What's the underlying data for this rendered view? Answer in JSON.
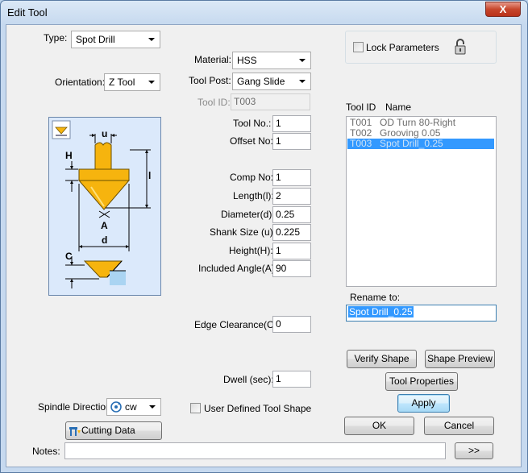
{
  "window": {
    "title": "Edit Tool",
    "close_glyph": "X"
  },
  "labels": {
    "type": "Type:",
    "orientation": "Orientation:",
    "material": "Material:",
    "tool_post": "Tool Post:",
    "tool_id": "Tool ID:",
    "tool_no": "Tool No.:",
    "offset_no": "Offset No:",
    "comp_no": "Comp No:",
    "length": "Length(l):",
    "diameter": "Diameter(d):",
    "shank_size": "Shank Size (u):",
    "height": "Height(H):",
    "included_angle": "Included Angle(A):",
    "edge_clearance": "Edge Clearance(C):",
    "dwell": "Dwell (sec):",
    "spindle_direction": "Spindle Direction:",
    "notes": "Notes:",
    "rename_to": "Rename to:",
    "lock_parameters": "Lock Parameters",
    "user_defined_shape": "User Defined Tool Shape"
  },
  "fields": {
    "type": "Spot Drill",
    "orientation": "Z Tool",
    "material": "HSS",
    "tool_post": "Gang Slide",
    "tool_id": "T003",
    "tool_no": "1",
    "offset_no": "1",
    "comp_no": "1",
    "length": "2",
    "diameter": "0.25",
    "shank_size": "0.225",
    "height": "1",
    "included_angle": "90",
    "edge_clearance": "0",
    "dwell": "1",
    "spindle_direction": "cw",
    "rename_to": "Spot Drill_0.25",
    "notes": ""
  },
  "tool_list": {
    "headers": {
      "id": "Tool ID",
      "name": "Name"
    },
    "rows": [
      {
        "id": "T001",
        "name": "OD Turn 80-Right",
        "selected": false
      },
      {
        "id": "T002",
        "name": "Grooving 0.05",
        "selected": false
      },
      {
        "id": "T003",
        "name": "Spot Drill_0.25",
        "selected": true
      }
    ]
  },
  "buttons": {
    "verify_shape": "Verify Shape",
    "shape_preview": "Shape Preview",
    "tool_properties": "Tool Properties",
    "apply": "Apply",
    "ok": "OK",
    "cancel": "Cancel",
    "cutting_data": "Cutting Data",
    "notes_expand": ">>"
  },
  "diagram": {
    "labels": {
      "u": "u",
      "H": "H",
      "l": "l",
      "A": "A",
      "d": "d",
      "C": "C"
    }
  },
  "icons": {
    "lock": "padlock-icon",
    "spindle": "spindle-rotation-icon",
    "cutting": "cutting-data-icon",
    "orient": "orientation-icon"
  },
  "colors": {
    "accent_selection": "#3399ff",
    "tool_gold": "#f6b40e",
    "diagram_bg": "#dbe9fb"
  }
}
